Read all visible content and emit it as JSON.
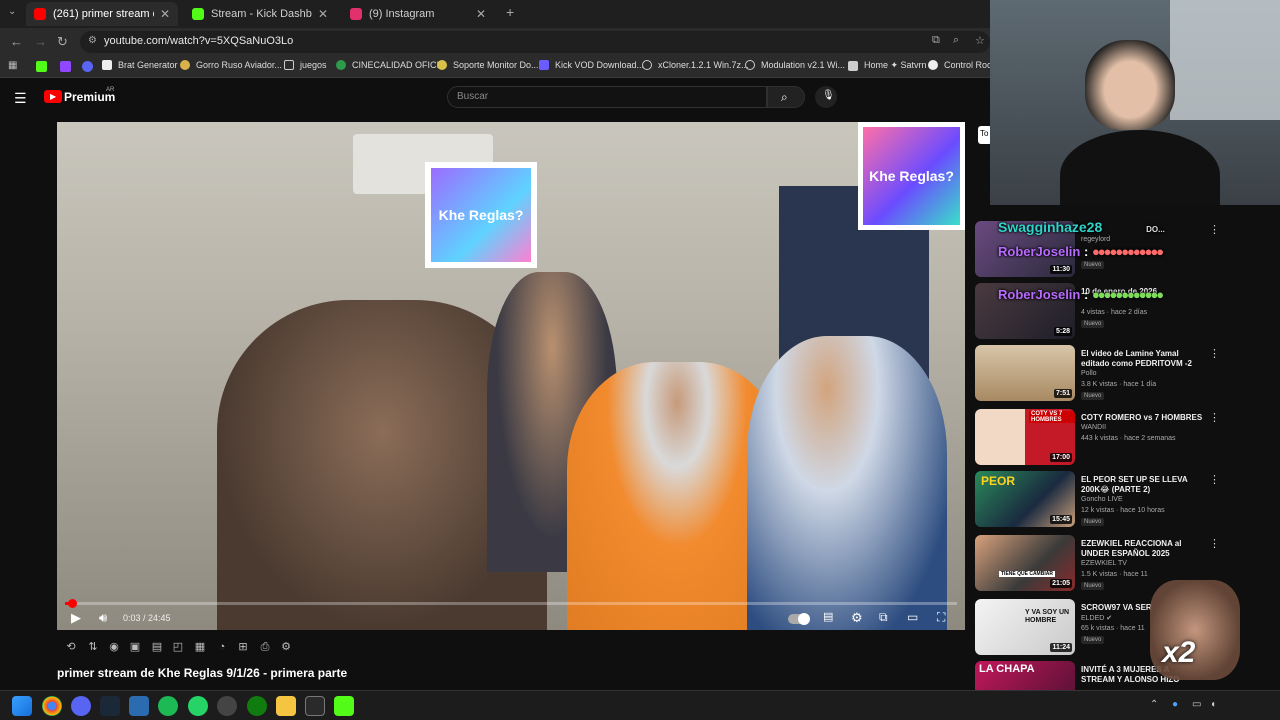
{
  "browser": {
    "tabs": [
      {
        "title": "(261) primer stream de Khe Reglas",
        "color": "#ff0000"
      },
      {
        "title": "Stream - Kick Dashboard",
        "color": "#53fc18"
      },
      {
        "title": "(9) Instagram",
        "color": "#e1306c"
      }
    ],
    "url": "youtube.com/watch?v=5XQSaNuO3Lo",
    "bookmarks": [
      "Brat Generator",
      "Gorro Ruso Aviador...",
      "juegos",
      "CINECALIDAD OFICI...",
      "Soporte Monitor Do...",
      "Kick VOD Download...",
      "xCloner.1.2.1 Win.7z...",
      "Modulation v2.1 Wi...",
      "Home ✦ Satvrn",
      "Control Room"
    ]
  },
  "youtube": {
    "logo_text": "Premium",
    "logo_region": "AR",
    "search_placeholder": "Buscar"
  },
  "video": {
    "time": "0:03 / 24:45",
    "progress": 0.002,
    "title": "primer stream de Khe Reglas 9/1/26 - primera parte",
    "poster_text": "Khe Reglas?"
  },
  "sidebar": {
    "tab_fragment": "To",
    "recommendations": [
      {
        "title": "",
        "channel": "regeylord",
        "meta": "",
        "badge": "Nuevo",
        "duration": "11:30"
      },
      {
        "title": "10 de enero de 2026",
        "channel": "",
        "meta": "4 vistas · hace 2 días",
        "badge": "Nuevo",
        "duration": "5:28"
      },
      {
        "title": "El video de Lamine Yamal editado como PEDRITOVM -2",
        "channel": "Pollo",
        "meta": "3.8 K vistas · hace 1 día",
        "badge": "Nuevo",
        "duration": "7:51"
      },
      {
        "title": "COTY ROMERO vs 7 HOMBRES",
        "channel": "WANDII",
        "meta": "443 k vistas · hace 2 semanas",
        "badge": "",
        "duration": "17:00"
      },
      {
        "title": "EL PEOR SET UP SE LLEVA 200K😂 (PARTE 2)",
        "channel": "Goncho LIVE",
        "meta": "12 k vistas · hace 10 horas",
        "badge": "Nuevo",
        "duration": "15:45"
      },
      {
        "title": "EZEWKIEL REACCIONA al UNDER ESPAÑOL 2025",
        "channel": "EZEWKIEL TV",
        "meta": "1.5 K vistas · hace 11",
        "badge": "Nuevo",
        "duration": "21:05"
      },
      {
        "title": "SCROW97 VA SER",
        "channel": "ELDED ✔",
        "meta": "65 k vistas · hace 11",
        "badge": "Nuevo",
        "duration": "11:24"
      },
      {
        "title": "INVITÉ A 3 MUJERES A STREAM Y ALONSO HIZO",
        "channel": "",
        "meta": "",
        "badge": "",
        "duration": ""
      }
    ]
  },
  "chat": [
    {
      "user": "Swagginhaze28",
      "color": "#2fd3c8",
      "message": "DO..."
    },
    {
      "user": "RoberJoselin",
      "color": "#b86bff",
      "message": ""
    },
    {
      "user": "RoberJoselin",
      "color": "#b86bff",
      "message": ""
    }
  ],
  "overlay": {
    "combo": "x2",
    "thumb_labels": [
      "Y VA SOY UN HOMBRE",
      "TIENE QUE CAMBIAR",
      "PEOR",
      "LA CHAPA",
      "COTY VS 7 HOMBRES"
    ]
  }
}
